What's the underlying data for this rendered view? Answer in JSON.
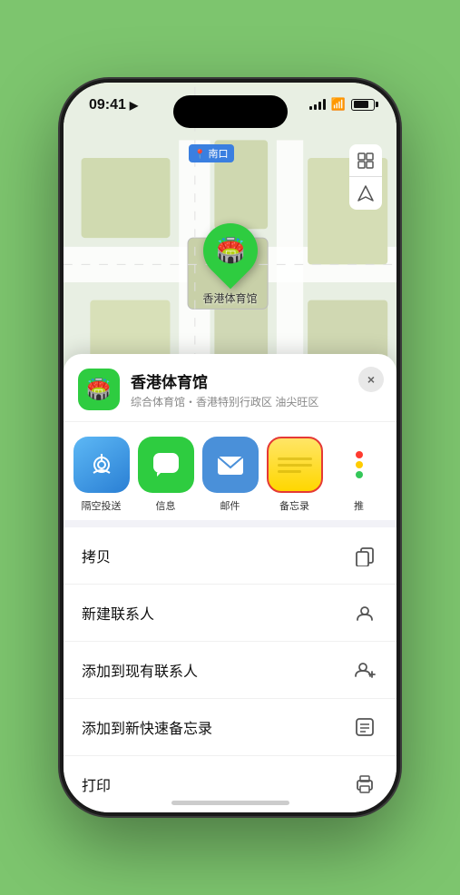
{
  "status_bar": {
    "time": "09:41",
    "location_arrow": "▶"
  },
  "map": {
    "label": "南口",
    "controls": [
      "map-view-icon",
      "location-arrow-icon"
    ],
    "marker_label": "香港体育馆"
  },
  "venue_card": {
    "title": "香港体育馆",
    "subtitle": "综合体育馆・香港特别行政区 油尖旺区",
    "close_label": "×"
  },
  "share_items": [
    {
      "id": "airdrop",
      "label": "隔空投送",
      "icon": "airdrop"
    },
    {
      "id": "message",
      "label": "信息",
      "icon": "message"
    },
    {
      "id": "mail",
      "label": "邮件",
      "icon": "mail"
    },
    {
      "id": "notes",
      "label": "备忘录",
      "icon": "notes"
    },
    {
      "id": "more",
      "label": "推",
      "icon": "more"
    }
  ],
  "action_items": [
    {
      "id": "copy",
      "label": "拷贝",
      "icon": "copy"
    },
    {
      "id": "new-contact",
      "label": "新建联系人",
      "icon": "new-contact"
    },
    {
      "id": "add-contact",
      "label": "添加到现有联系人",
      "icon": "add-contact"
    },
    {
      "id": "quick-note",
      "label": "添加到新快速备忘录",
      "icon": "quick-note"
    },
    {
      "id": "print",
      "label": "打印",
      "icon": "print"
    }
  ]
}
